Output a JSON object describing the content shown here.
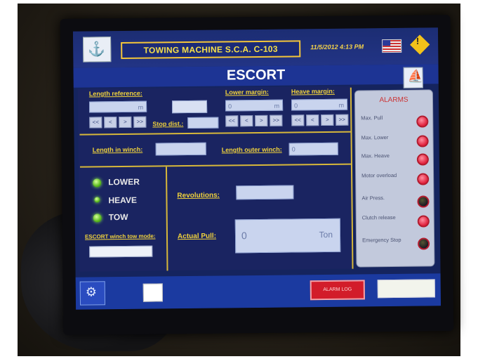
{
  "header": {
    "machine_name": "TOWING MACHINE S.C.A. C-103",
    "datetime": "11/5/2012 4:13 PM",
    "title": "ESCORT"
  },
  "length_reference": {
    "label": "Length reference:",
    "unit": "m",
    "arrows": [
      "<<",
      "<",
      ">",
      ">>"
    ]
  },
  "lower_margin": {
    "label": "Lower margin:",
    "value": "0",
    "unit": "m",
    "arrows": [
      "<<",
      "<",
      ">",
      ">>"
    ]
  },
  "heave_margin": {
    "label": "Heave margin:",
    "value": "0",
    "unit": "m",
    "arrows": [
      "<<",
      "<",
      ">",
      ">>"
    ]
  },
  "stop_dist": {
    "label": "Stop dist.:"
  },
  "length_in_winch": {
    "label": "Length in winch:"
  },
  "length_outer_winch": {
    "label": "Length outer winch:",
    "value": "0"
  },
  "modes": [
    {
      "label": "LOWER"
    },
    {
      "label": "HEAVE"
    },
    {
      "label": "TOW"
    }
  ],
  "escort_mode": {
    "label": "ESCORT winch tow mode:"
  },
  "revolutions": {
    "label": "Revolutions:"
  },
  "actual_pull": {
    "label": "Actual Pull:",
    "value": "0",
    "unit": "Ton"
  },
  "alarms": {
    "title": "ALARMS",
    "items": [
      {
        "label": "Max. Pull",
        "state": "on"
      },
      {
        "label": "Max. Lower",
        "state": "on"
      },
      {
        "label": "Max. Heave",
        "state": "on"
      },
      {
        "label": "Motor overload",
        "state": "on"
      },
      {
        "label": "Air Press.",
        "state": "off"
      },
      {
        "label": "Clutch release",
        "state": "on"
      },
      {
        "label": "Emergency Stop",
        "state": "off"
      }
    ]
  },
  "footer": {
    "alarm_log": "ALARM LOG"
  },
  "colors": {
    "accent": "#f0d23c",
    "screen": "#15245e",
    "alarm": "#e0203c"
  }
}
